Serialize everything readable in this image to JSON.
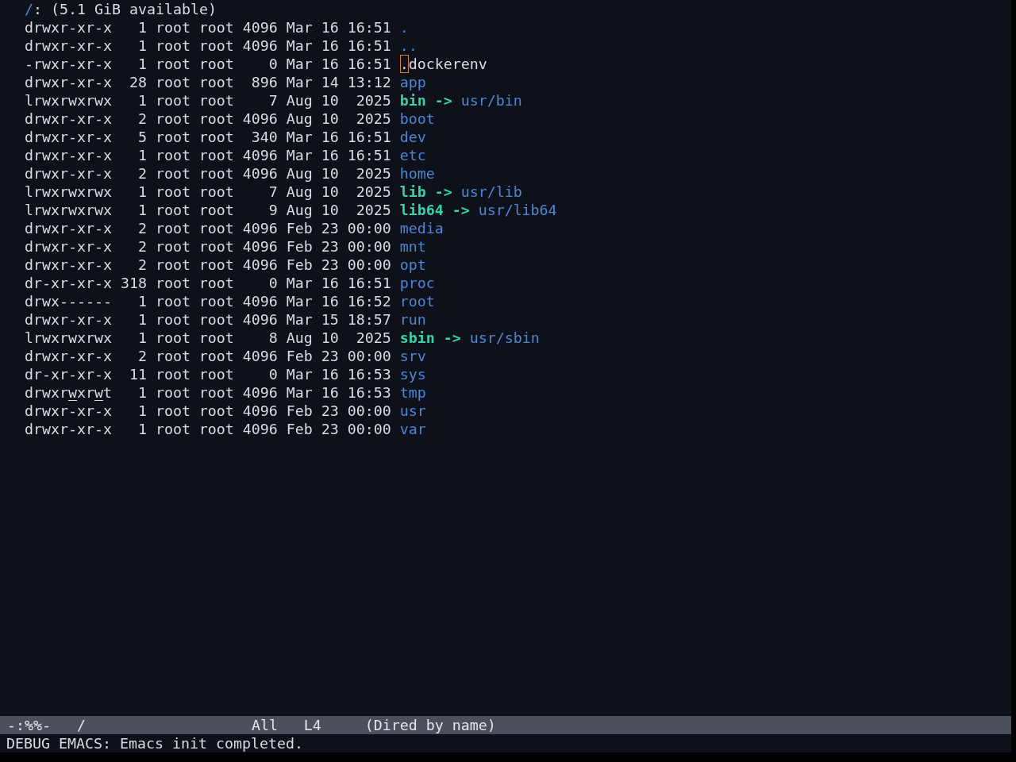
{
  "header": {
    "directory": "/",
    "info": ": (5.1 GiB available)"
  },
  "entries": [
    {
      "permissions": "drwxr-xr-x",
      "links": "1",
      "owner": "root",
      "group": "root",
      "size": "4096",
      "month": "Mar",
      "day": "16",
      "time": "16:51",
      "name": ".",
      "kind": "directory",
      "cursor": false,
      "world_writable": false
    },
    {
      "permissions": "drwxr-xr-x",
      "links": "1",
      "owner": "root",
      "group": "root",
      "size": "4096",
      "month": "Mar",
      "day": "16",
      "time": "16:51",
      "name": "..",
      "kind": "directory",
      "cursor": false,
      "world_writable": false
    },
    {
      "permissions": "-rwxr-xr-x",
      "links": "1",
      "owner": "root",
      "group": "root",
      "size": "0",
      "month": "Mar",
      "day": "16",
      "time": "16:51",
      "name": ".dockerenv",
      "kind": "file",
      "cursor": true,
      "world_writable": false
    },
    {
      "permissions": "drwxr-xr-x",
      "links": "28",
      "owner": "root",
      "group": "root",
      "size": "896",
      "month": "Mar",
      "day": "14",
      "time": "13:12",
      "name": "app",
      "kind": "directory",
      "cursor": false,
      "world_writable": false
    },
    {
      "permissions": "lrwxrwxrwx",
      "links": "1",
      "owner": "root",
      "group": "root",
      "size": "7",
      "month": "Aug",
      "day": "10",
      "time": "2025",
      "name": "bin",
      "kind": "symlink",
      "arrow": "->",
      "target": "usr/bin",
      "cursor": false,
      "world_writable": false
    },
    {
      "permissions": "drwxr-xr-x",
      "links": "2",
      "owner": "root",
      "group": "root",
      "size": "4096",
      "month": "Aug",
      "day": "10",
      "time": "2025",
      "name": "boot",
      "kind": "directory",
      "cursor": false,
      "world_writable": false
    },
    {
      "permissions": "drwxr-xr-x",
      "links": "5",
      "owner": "root",
      "group": "root",
      "size": "340",
      "month": "Mar",
      "day": "16",
      "time": "16:51",
      "name": "dev",
      "kind": "directory",
      "cursor": false,
      "world_writable": false
    },
    {
      "permissions": "drwxr-xr-x",
      "links": "1",
      "owner": "root",
      "group": "root",
      "size": "4096",
      "month": "Mar",
      "day": "16",
      "time": "16:51",
      "name": "etc",
      "kind": "directory",
      "cursor": false,
      "world_writable": false
    },
    {
      "permissions": "drwxr-xr-x",
      "links": "2",
      "owner": "root",
      "group": "root",
      "size": "4096",
      "month": "Aug",
      "day": "10",
      "time": "2025",
      "name": "home",
      "kind": "directory",
      "cursor": false,
      "world_writable": false
    },
    {
      "permissions": "lrwxrwxrwx",
      "links": "1",
      "owner": "root",
      "group": "root",
      "size": "7",
      "month": "Aug",
      "day": "10",
      "time": "2025",
      "name": "lib",
      "kind": "symlink",
      "arrow": "->",
      "target": "usr/lib",
      "cursor": false,
      "world_writable": false
    },
    {
      "permissions": "lrwxrwxrwx",
      "links": "1",
      "owner": "root",
      "group": "root",
      "size": "9",
      "month": "Aug",
      "day": "10",
      "time": "2025",
      "name": "lib64",
      "kind": "symlink",
      "arrow": "->",
      "target": "usr/lib64",
      "cursor": false,
      "world_writable": false
    },
    {
      "permissions": "drwxr-xr-x",
      "links": "2",
      "owner": "root",
      "group": "root",
      "size": "4096",
      "month": "Feb",
      "day": "23",
      "time": "00:00",
      "name": "media",
      "kind": "directory",
      "cursor": false,
      "world_writable": false
    },
    {
      "permissions": "drwxr-xr-x",
      "links": "2",
      "owner": "root",
      "group": "root",
      "size": "4096",
      "month": "Feb",
      "day": "23",
      "time": "00:00",
      "name": "mnt",
      "kind": "directory",
      "cursor": false,
      "world_writable": false
    },
    {
      "permissions": "drwxr-xr-x",
      "links": "2",
      "owner": "root",
      "group": "root",
      "size": "4096",
      "month": "Feb",
      "day": "23",
      "time": "00:00",
      "name": "opt",
      "kind": "directory",
      "cursor": false,
      "world_writable": false
    },
    {
      "permissions": "dr-xr-xr-x",
      "links": "318",
      "owner": "root",
      "group": "root",
      "size": "0",
      "month": "Mar",
      "day": "16",
      "time": "16:51",
      "name": "proc",
      "kind": "directory",
      "cursor": false,
      "world_writable": false
    },
    {
      "permissions": "drwx------",
      "links": "1",
      "owner": "root",
      "group": "root",
      "size": "4096",
      "month": "Mar",
      "day": "16",
      "time": "16:52",
      "name": "root",
      "kind": "directory",
      "cursor": false,
      "world_writable": false
    },
    {
      "permissions": "drwxr-xr-x",
      "links": "1",
      "owner": "root",
      "group": "root",
      "size": "4096",
      "month": "Mar",
      "day": "15",
      "time": "18:57",
      "name": "run",
      "kind": "directory",
      "cursor": false,
      "world_writable": false
    },
    {
      "permissions": "lrwxrwxrwx",
      "links": "1",
      "owner": "root",
      "group": "root",
      "size": "8",
      "month": "Aug",
      "day": "10",
      "time": "2025",
      "name": "sbin",
      "kind": "symlink",
      "arrow": "->",
      "target": "usr/sbin",
      "cursor": false,
      "world_writable": false
    },
    {
      "permissions": "drwxr-xr-x",
      "links": "2",
      "owner": "root",
      "group": "root",
      "size": "4096",
      "month": "Feb",
      "day": "23",
      "time": "00:00",
      "name": "srv",
      "kind": "directory",
      "cursor": false,
      "world_writable": false
    },
    {
      "permissions": "dr-xr-xr-x",
      "links": "11",
      "owner": "root",
      "group": "root",
      "size": "0",
      "month": "Mar",
      "day": "16",
      "time": "16:53",
      "name": "sys",
      "kind": "directory",
      "cursor": false,
      "world_writable": false
    },
    {
      "permissions": "drwxrwxrwt",
      "links": "1",
      "owner": "root",
      "group": "root",
      "size": "4096",
      "month": "Mar",
      "day": "16",
      "time": "16:53",
      "name": "tmp",
      "kind": "directory",
      "cursor": false,
      "world_writable": true
    },
    {
      "permissions": "drwxr-xr-x",
      "links": "1",
      "owner": "root",
      "group": "root",
      "size": "4096",
      "month": "Feb",
      "day": "23",
      "time": "00:00",
      "name": "usr",
      "kind": "directory",
      "cursor": false,
      "world_writable": false
    },
    {
      "permissions": "drwxr-xr-x",
      "links": "1",
      "owner": "root",
      "group": "root",
      "size": "4096",
      "month": "Feb",
      "day": "23",
      "time": "00:00",
      "name": "var",
      "kind": "directory",
      "cursor": false,
      "world_writable": false
    }
  ],
  "mode_line": {
    "status": "-:%%-",
    "buffer": "/",
    "position": "All",
    "line": "L4",
    "modes": "(Dired by name)"
  },
  "echo_area": {
    "message": "DEBUG EMACS: Emacs init completed."
  }
}
